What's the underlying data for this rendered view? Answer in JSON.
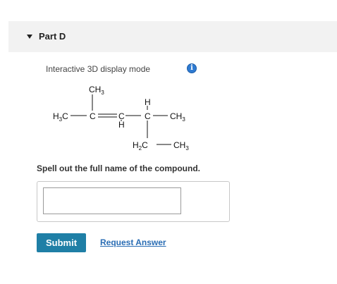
{
  "part": {
    "title": "Part D",
    "caret_icon": "caret-down-icon"
  },
  "display": {
    "mode_label": "Interactive 3D display mode",
    "info_icon": "info-icon",
    "info_glyph": "i",
    "accent_color": "#2f7bd2"
  },
  "structure": {
    "labels": {
      "ch3_top": "CH3",
      "h3c_left": "H3C",
      "c_left": "C",
      "c_middle": "C",
      "h_below_c_middle": "H",
      "h_above_c_right": "H",
      "c_right": "C",
      "ch3_right": "CH3",
      "h2c_branch": "H2C",
      "ch3_branch": "CH3"
    }
  },
  "question": {
    "prompt": "Spell out the full name of the compound.",
    "answer_value": "",
    "answer_placeholder": ""
  },
  "actions": {
    "submit_label": "Submit",
    "submit_color": "#1f7fa6",
    "request_answer_label": "Request Answer",
    "link_color": "#2a6db4"
  }
}
